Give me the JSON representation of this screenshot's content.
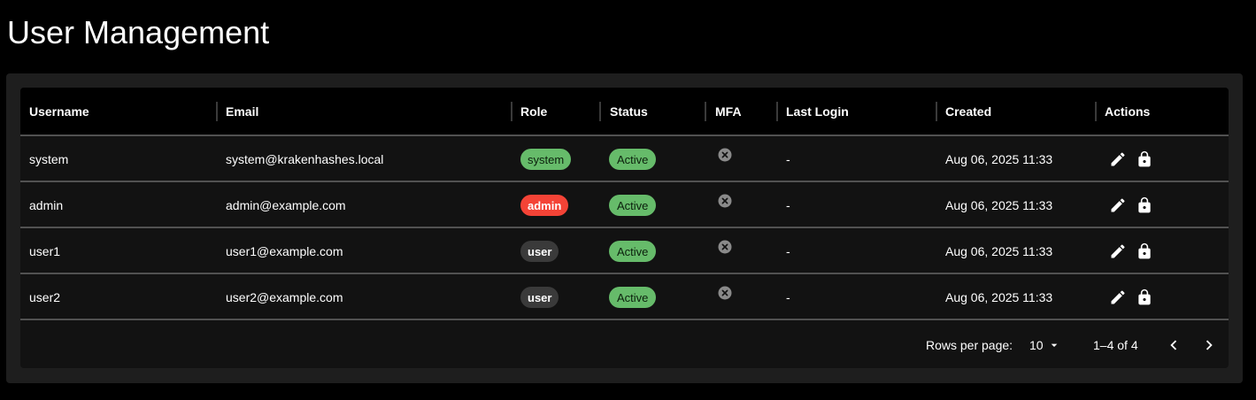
{
  "page": {
    "title": "User Management"
  },
  "table": {
    "columns": [
      "Username",
      "Email",
      "Role",
      "Status",
      "MFA",
      "Last Login",
      "Created",
      "Actions"
    ],
    "rows": [
      {
        "username": "system",
        "email": "system@krakenhashes.local",
        "role": "system",
        "status": "Active",
        "mfa": "disabled-icon",
        "last_login": "-",
        "created": "Aug 06, 2025 11:33"
      },
      {
        "username": "admin",
        "email": "admin@example.com",
        "role": "admin",
        "status": "Active",
        "mfa": "disabled-icon",
        "last_login": "-",
        "created": "Aug 06, 2025 11:33"
      },
      {
        "username": "user1",
        "email": "user1@example.com",
        "role": "user",
        "status": "Active",
        "mfa": "disabled-icon",
        "last_login": "-",
        "created": "Aug 06, 2025 11:33"
      },
      {
        "username": "user2",
        "email": "user2@example.com",
        "role": "user",
        "status": "Active",
        "mfa": "disabled-icon",
        "last_login": "-",
        "created": "Aug 06, 2025 11:33"
      }
    ],
    "actions": {
      "edit_icon": "pencil-icon",
      "lock_icon": "lock-icon"
    }
  },
  "pagination": {
    "rows_per_page_label": "Rows per page:",
    "rows_per_page_value": "10",
    "range_text": "1–4 of 4",
    "prev_icon": "chevron-left-icon",
    "next_icon": "chevron-right-icon"
  },
  "colors": {
    "background": "#000000",
    "panel": "#1e1e1e",
    "table": "#121212",
    "chip_green": "#66bb6a",
    "chip_red": "#f44336",
    "chip_gray": "#3a3a3a",
    "divider": "#515151"
  }
}
